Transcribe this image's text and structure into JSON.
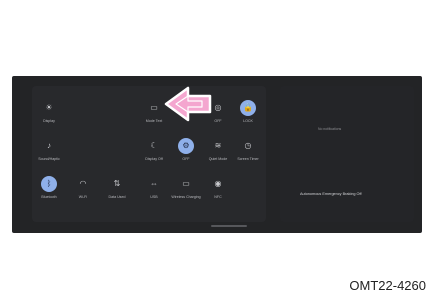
{
  "quick_settings": {
    "tiles": [
      {
        "id": "brightness",
        "icon": "brightness-icon",
        "glyph": "☀",
        "label": "Display",
        "active": false
      },
      {
        "id": "mode",
        "icon": "mode-icon",
        "glyph": "▭",
        "label": "Mode Text",
        "active": false
      },
      {
        "id": "off",
        "icon": "power-off-icon",
        "glyph": "◎",
        "label": "OFF",
        "active": false
      },
      {
        "id": "lock",
        "icon": "lock-icon",
        "glyph": "🔒",
        "label": "LOCK",
        "active": true
      },
      {
        "id": "sound",
        "icon": "sound-icon",
        "glyph": "♪",
        "label": "Sound/Haptic",
        "active": false
      },
      {
        "id": "night",
        "icon": "moon-icon",
        "glyph": "☾",
        "label": "Display Off",
        "active": false
      },
      {
        "id": "settings",
        "icon": "gear-icon",
        "glyph": "⚙",
        "label": "OFF",
        "active": true
      },
      {
        "id": "quiet",
        "icon": "quiet-icon",
        "glyph": "≋",
        "label": "Quiet Mode",
        "active": false
      },
      {
        "id": "screen-timer",
        "icon": "timer-icon",
        "glyph": "◷",
        "label": "Screen Timer",
        "active": false
      },
      {
        "id": "bluetooth",
        "icon": "bluetooth-icon",
        "glyph": "ᛒ",
        "label": "Bluetooth",
        "active": true
      },
      {
        "id": "wifi",
        "icon": "wifi-icon",
        "glyph": "◠",
        "label": "Wi-Fi",
        "active": false
      },
      {
        "id": "data",
        "icon": "data-icon",
        "glyph": "⇅",
        "label": "Data Used",
        "active": false
      },
      {
        "id": "usb",
        "icon": "usb-icon",
        "glyph": "⇔",
        "label": "USB",
        "active": false
      },
      {
        "id": "wireless",
        "icon": "wireless-icon",
        "glyph": "▭",
        "label": "Wireless Charging",
        "active": false
      },
      {
        "id": "nfc",
        "icon": "nfc-icon",
        "glyph": "◉",
        "label": "NFC",
        "active": false
      }
    ]
  },
  "right_panel": {
    "top_text": "No notifications",
    "message": "Autonomous Emergency Braking Off"
  },
  "caption": "OMT22-4260",
  "colors": {
    "active": "#8fb0ea",
    "arrow": "#f4a6cf"
  }
}
